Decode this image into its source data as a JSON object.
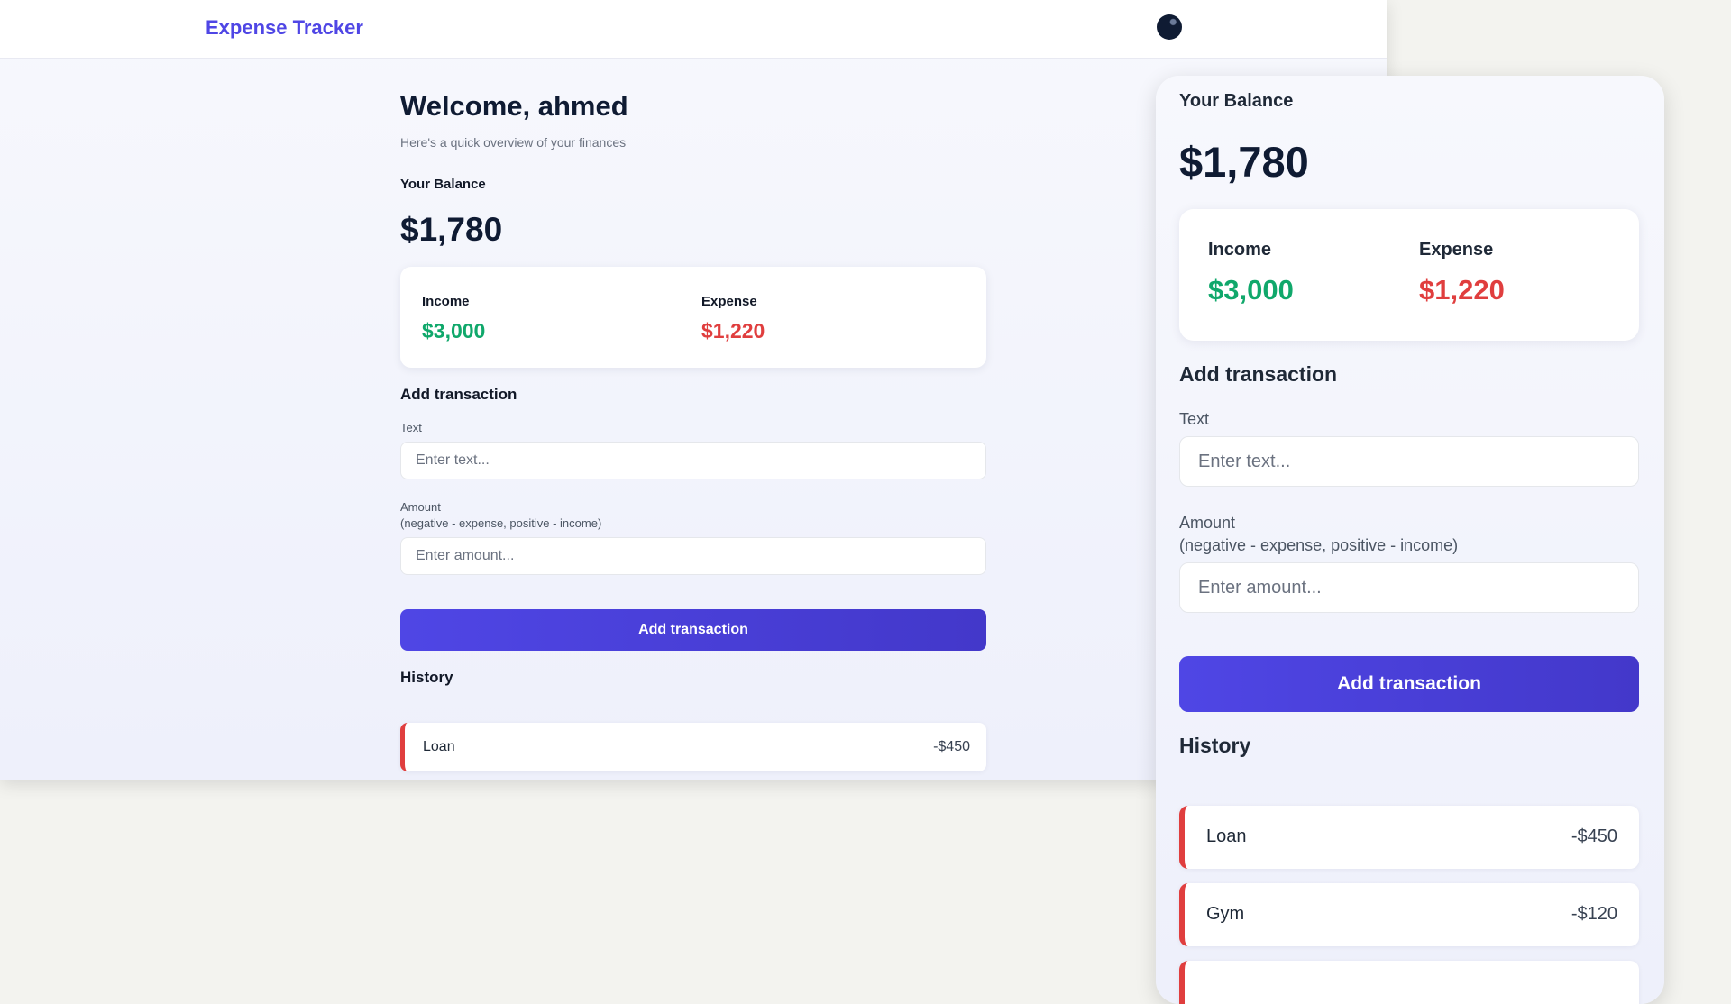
{
  "app": {
    "title": "Expense Tracker"
  },
  "page": {
    "welcome": "Welcome, ahmed",
    "subtitle": "Here's a quick overview of your finances",
    "balance_label": "Your Balance",
    "balance": "$1,780"
  },
  "summary": {
    "income_label": "Income",
    "income": "$3,000",
    "expense_label": "Expense",
    "expense": "$1,220"
  },
  "form": {
    "title": "Add transaction",
    "text_label": "Text",
    "text_placeholder": "Enter text...",
    "amount_label": "Amount",
    "amount_hint": "(negative - expense, positive - income)",
    "amount_placeholder": "Enter amount...",
    "submit_label": "Add transaction"
  },
  "history": {
    "title": "History",
    "items": [
      {
        "text": "Loan",
        "amount": "-$450"
      },
      {
        "text": "Gym",
        "amount": "-$120"
      }
    ]
  },
  "colors": {
    "accent": "#4f46e5",
    "income": "#10a86b",
    "expense": "#e03e3e"
  }
}
